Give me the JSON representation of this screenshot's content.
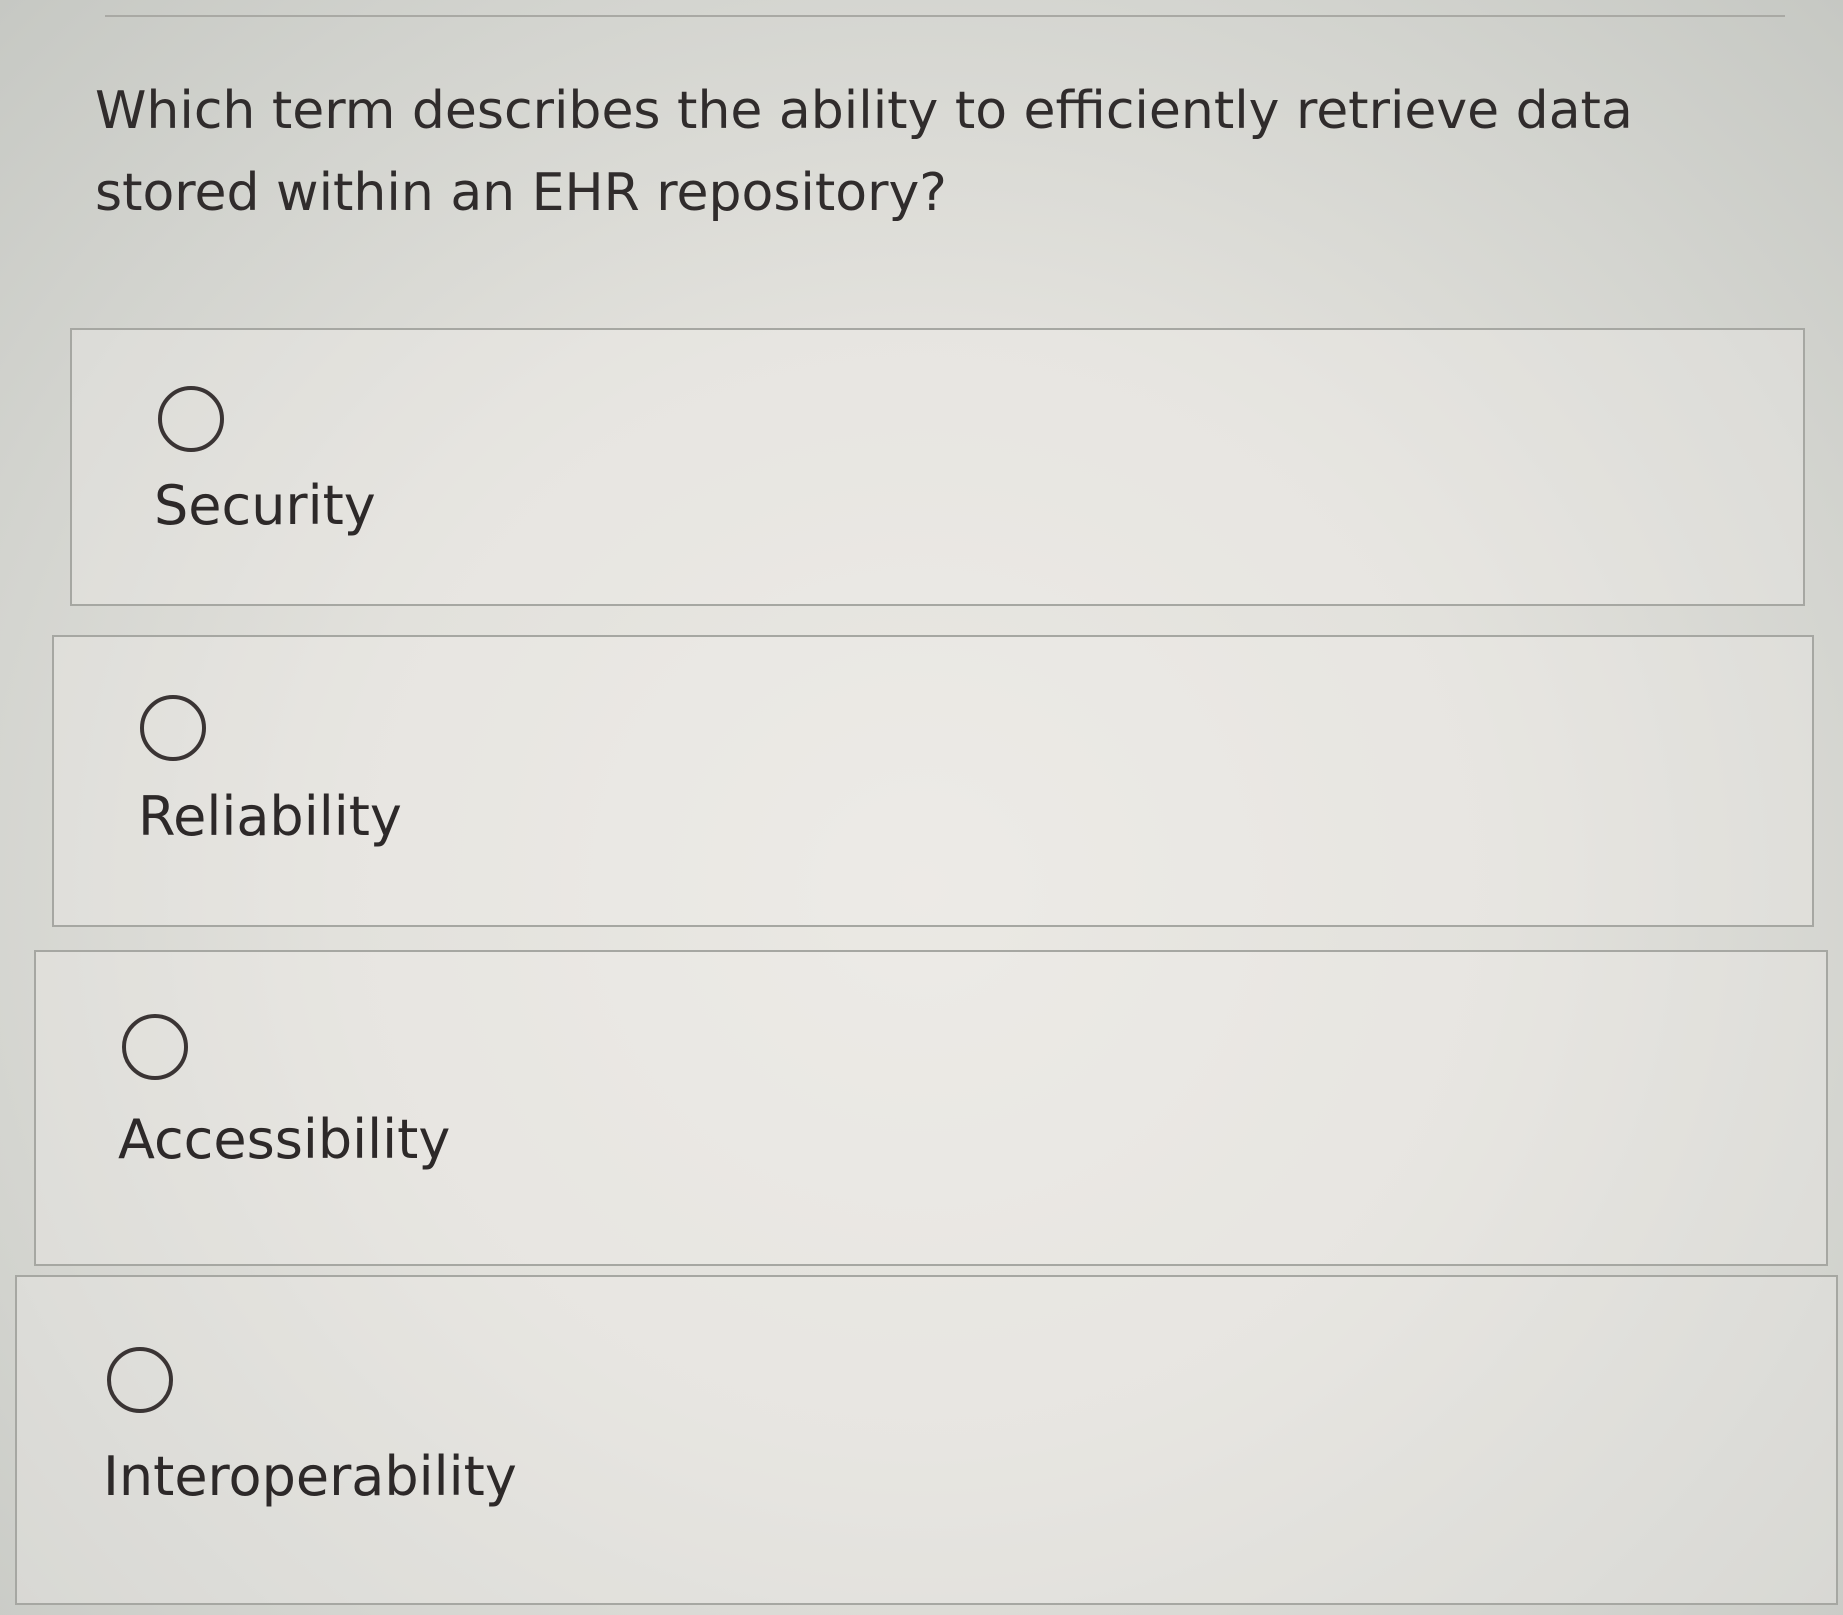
{
  "question": {
    "text": "Which term describes the ability to efficiently retrieve data stored within an EHR repository?"
  },
  "options": [
    {
      "label": "Security",
      "selected": false
    },
    {
      "label": "Reliability",
      "selected": false
    },
    {
      "label": "Accessibility",
      "selected": false
    },
    {
      "label": "Interoperability",
      "selected": false
    }
  ],
  "icons": {
    "radio": "radio-unchecked-icon"
  },
  "colors": {
    "text": "#2f2b2b",
    "border": "#a6a7a2",
    "radio_ring": "#3a3434"
  }
}
